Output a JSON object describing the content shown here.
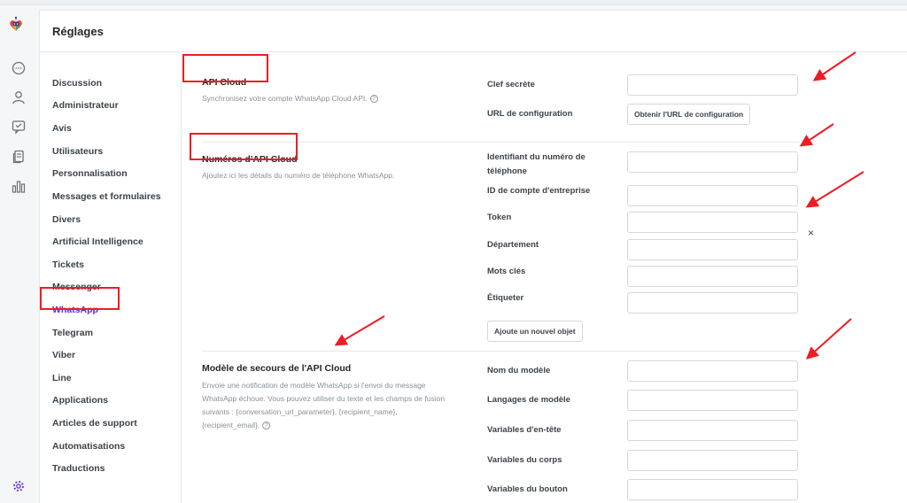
{
  "header": {
    "title": "Réglages"
  },
  "rail": {
    "logo": "robot-heart-logo-icon",
    "icons": [
      "chat-bubble-icon",
      "user-icon",
      "ticket-icon",
      "articles-icon",
      "reports-bar-chart-icon"
    ],
    "bottom_icon": "settings-gear-icon"
  },
  "nav": {
    "items": [
      {
        "label": "Discussion"
      },
      {
        "label": "Administrateur"
      },
      {
        "label": "Avis"
      },
      {
        "label": "Utilisateurs"
      },
      {
        "label": "Personnalisation"
      },
      {
        "label": "Messages et formulaires"
      },
      {
        "label": "Divers"
      },
      {
        "label": "Artificial Intelligence"
      },
      {
        "label": "Tickets"
      },
      {
        "label": "Messenger"
      },
      {
        "label": "WhatsApp",
        "active": true
      },
      {
        "label": "Telegram"
      },
      {
        "label": "Viber"
      },
      {
        "label": "Line"
      },
      {
        "label": "Applications"
      },
      {
        "label": "Articles de support"
      },
      {
        "label": "Automatisations"
      },
      {
        "label": "Traductions"
      }
    ]
  },
  "sections": {
    "api_cloud": {
      "title": "API Cloud",
      "description": "Synchronisez votre compte WhatsApp Cloud API.",
      "secret_key_label": "Clef secrète",
      "secret_key_value": "",
      "config_url_label": "URL de configuration",
      "config_url_button": "Obtenir l'URL de configuration"
    },
    "numbers": {
      "title": "Numéros d'API Cloud",
      "description": "Ajoutez ici les détails du numéro de téléphone WhatsApp.",
      "phone_id_label": "Identifiant du numéro de téléphone",
      "business_account_label": "ID de compte d'entreprise",
      "token_label": "Token",
      "department_label": "Département",
      "keywords_label": "Mots clés",
      "tag_label": "Étiqueter",
      "remove_symbol": "×",
      "add_button": "Ajoute un nouvel objet"
    },
    "fallback": {
      "title": "Modèle de secours de l'API Cloud",
      "description": "Envoie une notification de modèle WhatsApp si l'envoi du message WhatsApp échoue. Vous pouvez utiliser du texte et les champs de fusion suivants : {conversation_url_parameter}, {recipient_name}, {recipient_email}.",
      "template_name_label": "Nom du modèle",
      "template_languages_label": "Langages de modèle",
      "header_variables_label": "Variables d'en-tête",
      "body_variables_label": "Variables du corps",
      "button_variables_label": "Variables du bouton"
    }
  },
  "help_glyph": "?",
  "colors": {
    "accent": "#5b2de0",
    "annotation": "#ee1c25",
    "text": "#24272a",
    "muted": "#8b9197"
  }
}
